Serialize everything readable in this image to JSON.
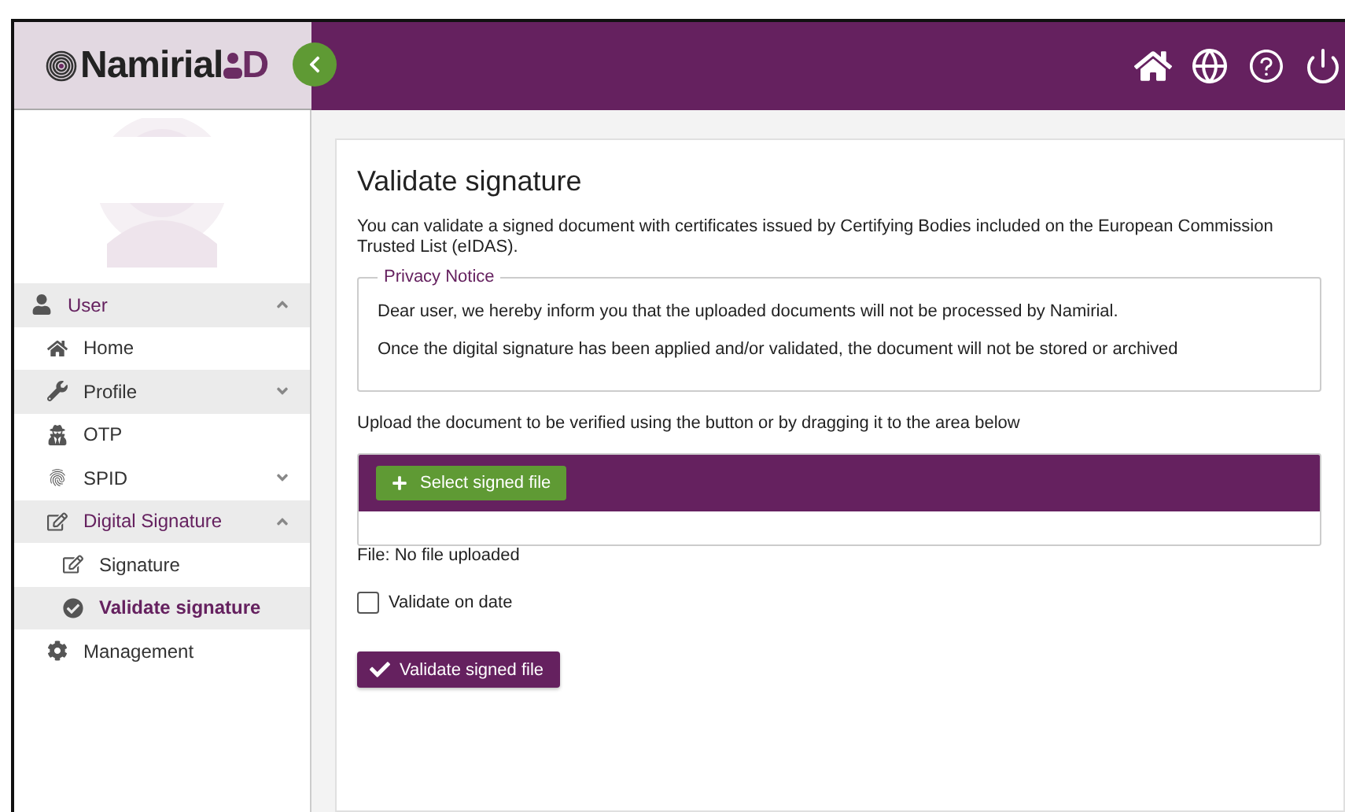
{
  "logo": {
    "brand": "Namirial",
    "suffix": "D"
  },
  "sidebar": {
    "items": [
      {
        "label": "User",
        "expanded": true,
        "highlighted": true,
        "selected": false,
        "children": [
          {
            "label": "Home",
            "highlighted": false,
            "selected": false
          },
          {
            "label": "Profile",
            "expanded": false,
            "highlighted": true,
            "selected": false
          },
          {
            "label": "OTP",
            "highlighted": false,
            "selected": false
          },
          {
            "label": "SPID",
            "expanded": false,
            "highlighted": false,
            "selected": false
          },
          {
            "label": "Digital Signature",
            "expanded": true,
            "highlighted": true,
            "selected": false,
            "children": [
              {
                "label": "Signature",
                "highlighted": false,
                "selected": false
              },
              {
                "label": "Validate signature",
                "highlighted": true,
                "selected": true
              }
            ]
          },
          {
            "label": "Management",
            "highlighted": false,
            "selected": false
          }
        ]
      }
    ]
  },
  "page": {
    "title": "Validate signature",
    "intro": "You can validate a signed document with certificates issued by Certifying Bodies included on the European Commission Trusted List (eIDAS).",
    "privacy": {
      "legend": "Privacy Notice",
      "paragraphs": [
        "Dear user, we hereby inform you that the uploaded documents will not be processed by Namirial.",
        "Once the digital signature has been applied and/or validated, the document will not be stored or archived"
      ]
    },
    "upload_hint": "Upload the document to be verified using the button or by dragging it to the area below",
    "select_button": "Select signed file",
    "file_status": "File: No file uploaded",
    "validate_on_date": {
      "label": "Validate on date",
      "checked": false
    },
    "validate_button": "Validate signed file"
  }
}
